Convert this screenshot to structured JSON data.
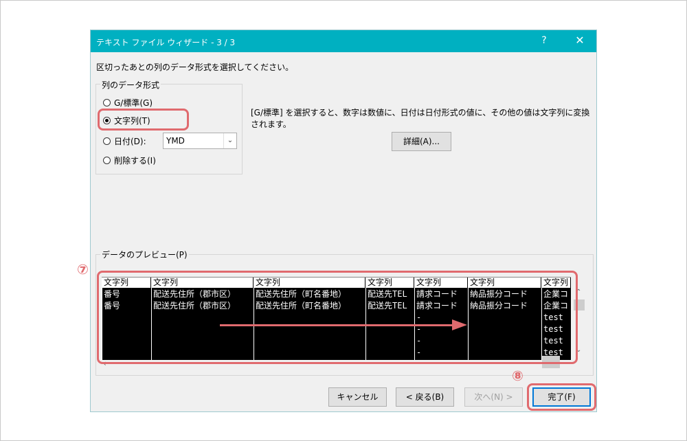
{
  "dialog": {
    "title": "テキスト ファイル ウィザード - 3 / 3",
    "help": "?",
    "close": "✕",
    "instruction": "区切ったあとの列のデータ形式を選択してください。"
  },
  "format_group": {
    "legend": "列のデータ形式",
    "options": [
      {
        "label": "G/標準(G)",
        "selected": false
      },
      {
        "label": "文字列(T)",
        "selected": true
      },
      {
        "label": "日付(D):",
        "selected": false
      },
      {
        "label": "削除する(I)",
        "selected": false
      }
    ],
    "date_combo_value": "YMD"
  },
  "description": "[G/標準] を選択すると、数字は数値に、日付は日付形式の値に、その他の値は文字列に変換されます。",
  "buttons": {
    "details": "詳細(A)...",
    "cancel": "キャンセル",
    "back": "< 戻る(B)",
    "next": "次へ(N) >",
    "finish": "完了(F)"
  },
  "preview": {
    "label": "データのプレビュー(P)",
    "columns": [
      {
        "header": "文字列",
        "cells": [
          "番号",
          "番号"
        ]
      },
      {
        "header": "文字列",
        "cells": [
          "配送先住所（郡市区）",
          "配送先住所（郡市区）"
        ]
      },
      {
        "header": "文字列",
        "cells": [
          "配送先住所（町名番地）",
          "配送先住所（町名番地）"
        ]
      },
      {
        "header": "文字列",
        "cells": [
          "配送先TEL",
          "配送先TEL"
        ]
      },
      {
        "header": "文字列",
        "cells": [
          "請求コード",
          "請求コード",
          "-",
          "-",
          "-",
          "-"
        ]
      },
      {
        "header": "文字列",
        "cells": [
          "納品振分コード",
          "納品振分コード"
        ]
      },
      {
        "header": "文字列",
        "cells": [
          "企業コ",
          "企業コ",
          "test",
          "test",
          "test",
          "test"
        ]
      }
    ]
  },
  "annotations": {
    "step7": "⑦",
    "step8": "⑧",
    "color": "#e06a6e"
  }
}
